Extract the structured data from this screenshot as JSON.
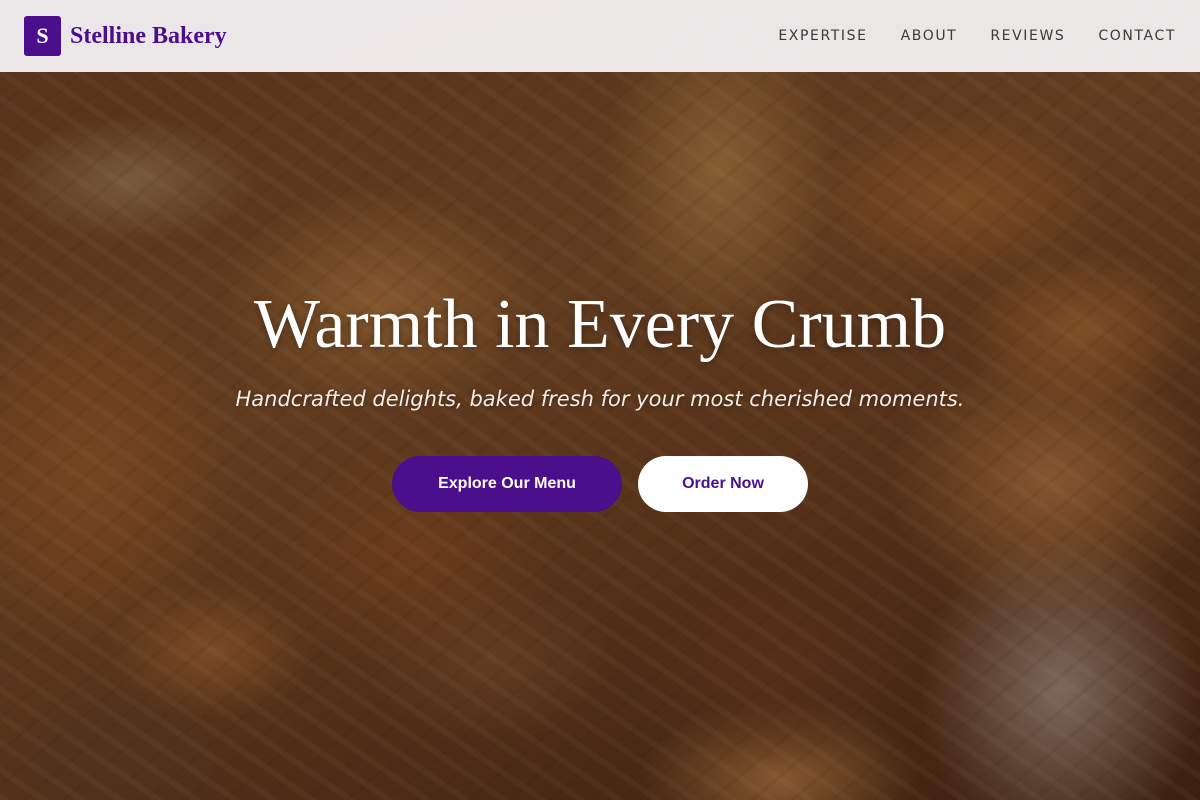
{
  "brand": {
    "initial": "S",
    "name": "Stelline Bakery"
  },
  "nav": {
    "items": [
      {
        "label": "EXPERTISE"
      },
      {
        "label": "ABOUT"
      },
      {
        "label": "REVIEWS"
      },
      {
        "label": "CONTACT"
      }
    ]
  },
  "hero": {
    "title": "Warmth in Every Crumb",
    "subtitle": "Handcrafted delights, baked fresh for your most cherished moments.",
    "primary_button": "Explore Our Menu",
    "secondary_button": "Order Now",
    "background_image": "assorted-bread-loaves-in-basket"
  },
  "colors": {
    "brand_purple": "#4b0f8c",
    "header_background": "#f3f0f2",
    "hero_text": "#ffffff",
    "secondary_button_background": "#ffffff"
  }
}
